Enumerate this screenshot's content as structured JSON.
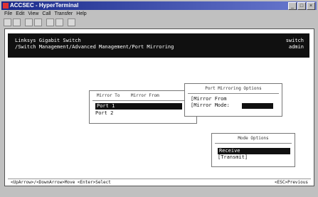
{
  "window": {
    "title": "ACCSEC - HyperTerminal",
    "buttons": [
      "_",
      "□",
      "×"
    ]
  },
  "menubar": [
    "File",
    "Edit",
    "View",
    "Call",
    "Transfer",
    "Help"
  ],
  "header": {
    "line1_left": "Linksys Gigabit Switch",
    "line2_left": "/Switch Management/Advanced Management/Port Mirroring",
    "line1_right": "switch",
    "line2_right": "admin"
  },
  "mirror_list": {
    "col1": "Mirror To",
    "col2": "Mirror From",
    "rows": [
      "Port 1",
      "Port 2"
    ]
  },
  "port_options": {
    "title": "Port Mirroring Options",
    "field1": "[Mirror From",
    "field2": "[Mirror Mode:"
  },
  "mode_options": {
    "title": "Mode Options",
    "items": [
      "Receive",
      "[Transmit]"
    ]
  },
  "status": {
    "left": "<UpArrow>/<DownArrow>Move  <Enter>Select",
    "right": "<ESC>Previous"
  }
}
